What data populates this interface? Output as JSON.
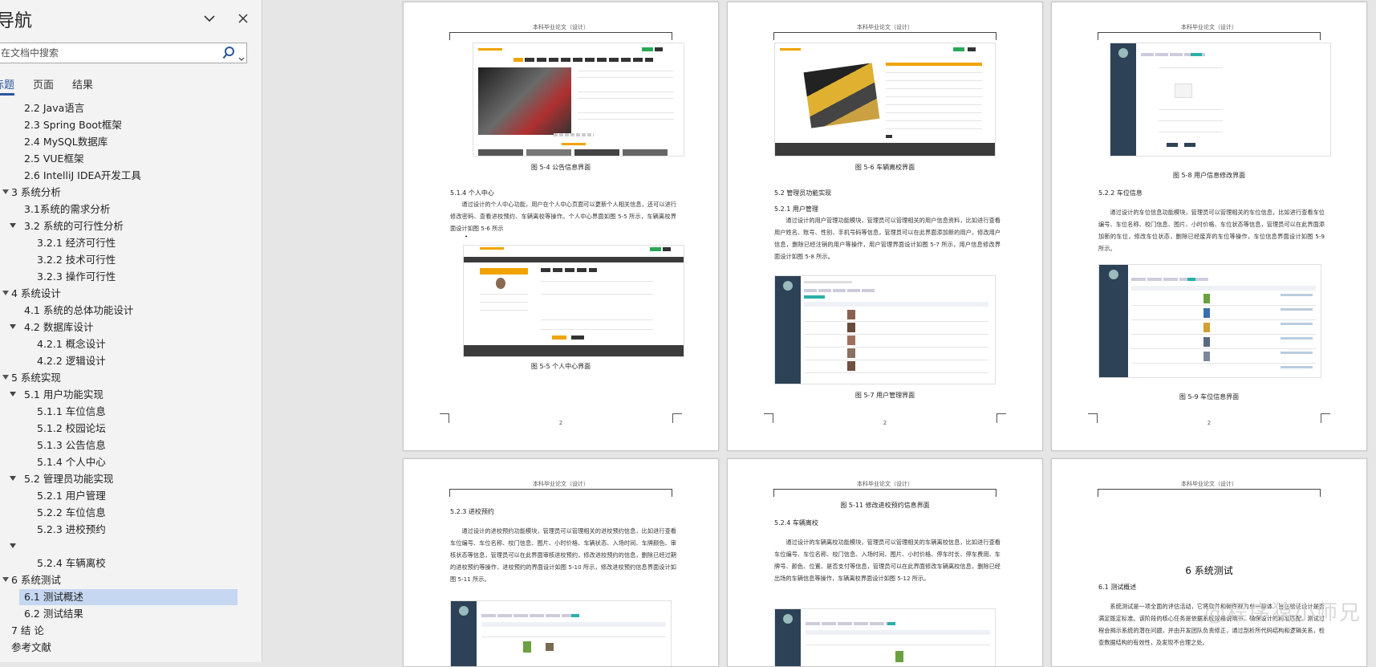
{
  "nav": {
    "title": "导航",
    "search_placeholder": "在文档中搜索",
    "tabs": [
      "标题",
      "页面",
      "结果"
    ],
    "items": [
      {
        "label": "2.2 Java语言",
        "level": 2,
        "caret": false
      },
      {
        "label": "2.3 Spring Boot框架",
        "level": 2,
        "caret": false
      },
      {
        "label": "2.4 MySQL数据库",
        "level": 2,
        "caret": false
      },
      {
        "label": "2.5 VUE框架",
        "level": 2,
        "caret": false
      },
      {
        "label": "2.6 IntelliJ IDEA开发工具",
        "level": 2,
        "caret": false
      },
      {
        "label": "3 系统分析",
        "level": 1,
        "caret": true
      },
      {
        "label": "3.1系统的需求分析",
        "level": 2,
        "caret": false
      },
      {
        "label": "3.2 系统的可行性分析",
        "level": 2,
        "caret": true
      },
      {
        "label": "3.2.1 经济可行性",
        "level": 3,
        "caret": false
      },
      {
        "label": "3.2.2 技术可行性",
        "level": 3,
        "caret": false
      },
      {
        "label": "3.2.3 操作可行性",
        "level": 3,
        "caret": false
      },
      {
        "label": "4 系统设计",
        "level": 1,
        "caret": true
      },
      {
        "label": "4.1 系统的总体功能设计",
        "level": 2,
        "caret": false
      },
      {
        "label": "4.2 数据库设计",
        "level": 2,
        "caret": true
      },
      {
        "label": "4.2.1 概念设计",
        "level": 3,
        "caret": false
      },
      {
        "label": "4.2.2 逻辑设计",
        "level": 3,
        "caret": false
      },
      {
        "label": "5 系统实现",
        "level": 1,
        "caret": true
      },
      {
        "label": "5.1 用户功能实现",
        "level": 2,
        "caret": true
      },
      {
        "label": "5.1.1 车位信息",
        "level": 3,
        "caret": false
      },
      {
        "label": "5.1.2 校园论坛",
        "level": 3,
        "caret": false
      },
      {
        "label": "5.1.3 公告信息",
        "level": 3,
        "caret": false
      },
      {
        "label": "5.1.4 个人中心",
        "level": 3,
        "caret": false
      },
      {
        "label": "5.2 管理员功能实现",
        "level": 2,
        "caret": true
      },
      {
        "label": "5.2.1 用户管理",
        "level": 3,
        "caret": false
      },
      {
        "label": "5.2.2 车位信息",
        "level": 3,
        "caret": false
      },
      {
        "label": "5.2.3 进校预约",
        "level": 3,
        "caret": false
      },
      {
        "label": "",
        "level": 3,
        "caret": true
      },
      {
        "label": "5.2.4 车辆离校",
        "level": 3,
        "caret": false
      },
      {
        "label": "6 系统测试",
        "level": 1,
        "caret": true
      },
      {
        "label": "6.1 测试概述",
        "level": 2,
        "caret": false,
        "selected": true
      },
      {
        "label": "6.2 测试结果",
        "level": 2,
        "caret": false
      },
      {
        "label": "7 结 论",
        "level": 1,
        "caret": false
      },
      {
        "label": "参考文献",
        "level": 1,
        "caret": false
      }
    ]
  },
  "doc": {
    "header_text": "本科毕业论文（设计）",
    "p1": {
      "caption1": "图 5-4 公告信息界面",
      "heading": "5.1.4 个人中心",
      "para": "通过设计的个人中心功能，用户在个人中心页面可以更新个人相关信息，还可以进行修改密码、查看进校预约、车辆离校等操作。个人中心界面如图 5-5 所示，车辆离校界面设计如图 5-6 所示",
      "caption2": "图 5-5 个人中心界面",
      "pagenum": "2"
    },
    "p2": {
      "caption1": "图 5-6 车辆离校界面",
      "heading1": "5.2 管理员功能实现",
      "heading2": "5.2.1 用户管理",
      "para": "通过设计的用户管理功能模块，管理员可以管理相关的用户信息资料，比如进行查看用户姓名、账号、性别、手机号码等信息，管理员可以在此界面添加新的用户，修改用户信息，删除已经注销的用户等操作，用户管理界面设计如图 5-7 所示，用户信息修改界面设计如图 5-8 所示。",
      "caption2": "图 5-7 用户管理界面",
      "pagenum": "2"
    },
    "p3": {
      "caption1": "图 5-8 用户信息修改界面",
      "heading": "5.2.2 车位信息",
      "para": "通过设计的车位信息功能模块，管理员可以管理相关的车位信息，比如进行查看车位编号、车位名称、校门信息、图片、小时价格、车位状态等信息，管理员可以在此界面添加新的车位，修改车位状态，删除已经废弃的车位等操作，车位信息界面设计如图 5-9 所示。",
      "caption2": "图 5-9 车位信息界面",
      "pagenum": "2"
    },
    "p4": {
      "heading": "5.2.3 进校预约",
      "para": "通过设计的进校预约功能模块，管理员可以管理相关的进校预约信息，比如进行查看车位编号、车位名称、校门信息、图片、小时价格、车辆状态、入场时间、车牌颜色、审核状态等信息，管理员可以在此界面审核进校预约，修改进校预约的信息，删除已经过期的进校预约等操作，进校预约的界面设计如图 5-10 所示，修改进校预约信息界面设计如图 5-11 所示。"
    },
    "p5": {
      "caption1": "图 5-11 修改进校预约信息界面",
      "heading": "5.2.4 车辆离校",
      "para": "通过设计的车辆离校功能模块，管理员可以管理相关的车辆离校信息，比如进行查看车位编号、车位名称、校门信息、入场时间、图片、小时价格、停车时长、停车费用、车牌号、颜色、位置、是否支付等信息，管理员可以在此界面修改车辆离校信息，删除已经出场的车辆信息等操作，车辆离校界面设计如图 5-12 所示。"
    },
    "p6": {
      "big_heading": "6 系统测试",
      "heading": "6.1 测试概述",
      "para": "系统测试是一项全面的评估活动，它将软件和硬件视为单一整体，旨在验证设计是否满足既定标准。该阶段的核心任务是依据系统规格说明书，确保设计的精准匹配。测试过程会揭示系统的潜在问题，并由开发团队负责修正，通过剖析所代码结构和逻辑关系，检查数据结构的有效性，及发现不合理之处。",
      "watermark": "@程序猿小师兄"
    }
  }
}
